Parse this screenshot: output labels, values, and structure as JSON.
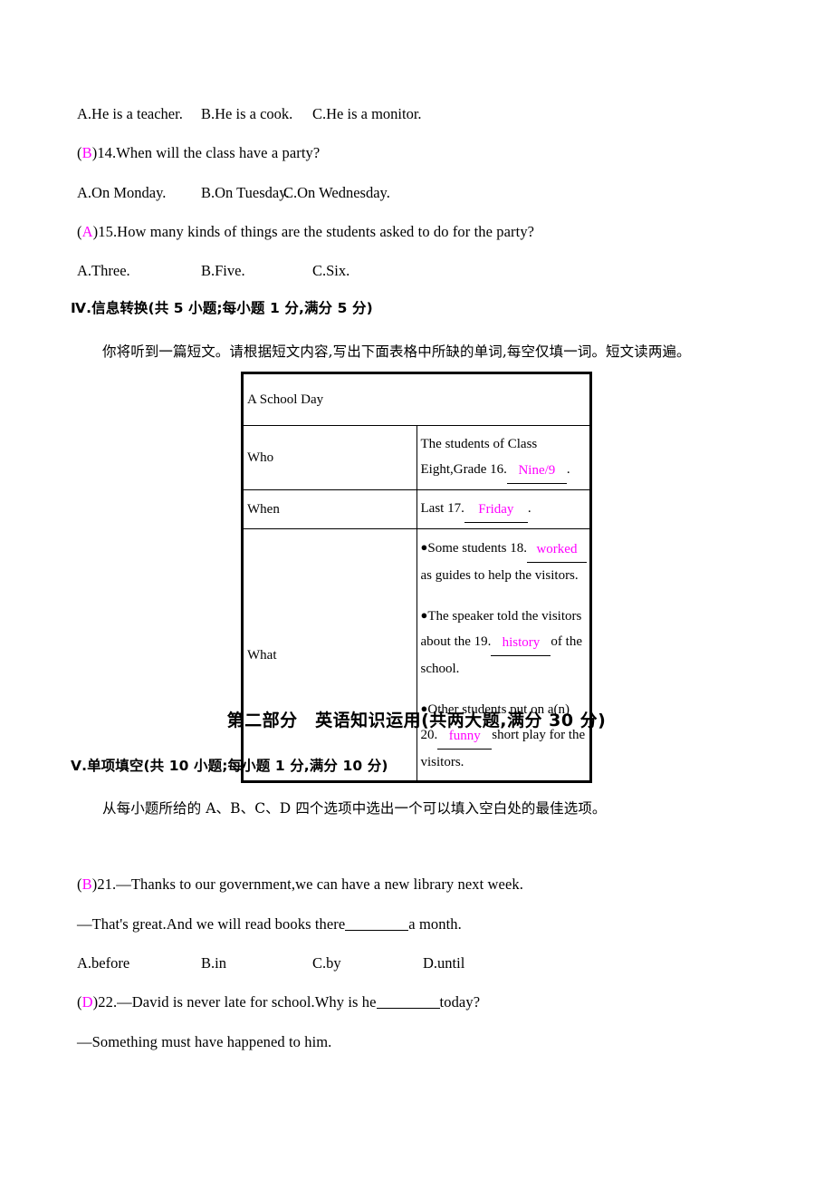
{
  "colors": {
    "answer": "#ff00ff",
    "text": "#000000",
    "page": "#ffffff"
  },
  "listening_tail": {
    "q13_options": [
      {
        "label": "A.He is a teacher."
      },
      {
        "label": "B.He is a cook."
      },
      {
        "label": "C.He is a monitor."
      }
    ],
    "q14": {
      "answer": "B",
      "paren_open": "(",
      "paren_close": ")",
      "number_text": "14.When will the class have a party?",
      "options": [
        {
          "label": "A.On Monday."
        },
        {
          "label": "B.On Tuesday."
        },
        {
          "label": "C.On Wednesday."
        }
      ]
    },
    "q15": {
      "answer": "A",
      "paren_open": "(",
      "paren_close": ")",
      "number_text": "15.How many kinds of things are the students asked to do for the party?",
      "options": [
        {
          "label": "A.Three."
        },
        {
          "label": "B.Five."
        },
        {
          "label": "C.Six."
        }
      ]
    }
  },
  "section_iv": {
    "heading": "Ⅳ.信息转换(共 5 小题;每小题 1 分,满分 5 分)",
    "instruction": "你将听到一篇短文。请根据短文内容,写出下面表格中所缺的单词,每空仅填一词。短文读两遍。",
    "table": {
      "title": "A School Day",
      "rows": [
        {
          "label": "Who",
          "pre": "The students of Class Eight,Grade 16.",
          "answer": "Nine/9",
          "post": "."
        },
        {
          "label": "When",
          "pre": "Last 17.",
          "answer": "Friday",
          "post": "."
        }
      ],
      "what_label": "What",
      "what_items": [
        {
          "pre": "Some students 18.",
          "answer": "worked",
          "post": "as guides to help the visitors."
        },
        {
          "pre": "The speaker told the visitors about the 19.",
          "answer": "history",
          "post": "of the school."
        },
        {
          "pre": "Other students put on a(n) 20.",
          "answer": "funny",
          "post": "short play for the visitors."
        }
      ]
    }
  },
  "part_two": {
    "title": "第二部分　英语知识运用(共两大题,满分 30 分)",
    "section_v": {
      "heading": "Ⅴ.单项填空(共 10 小题;每小题 1 分,满分 10 分)",
      "instruction": "从每小题所给的 A、B、C、D 四个选项中选出一个可以填入空白处的最佳选项。",
      "questions": [
        {
          "answer": "B",
          "paren_open": "(",
          "paren_close": ")",
          "stem": "21.—Thanks to our government,we can have a new library next week.",
          "reply_pre": "—That's great.And we will read books there",
          "reply_post": "a month.",
          "options": [
            {
              "label": "A.before"
            },
            {
              "label": "B.in"
            },
            {
              "label": "C.by"
            },
            {
              "label": "D.until"
            }
          ]
        },
        {
          "answer": "D",
          "paren_open": "(",
          "paren_close": ")",
          "stem_pre": "22.—David is never late for school.Why is he",
          "stem_post": "today?",
          "reply": "—Something must have happened to him."
        }
      ]
    }
  }
}
